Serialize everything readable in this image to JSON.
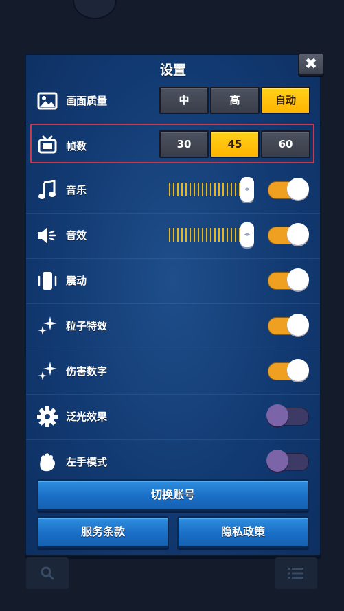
{
  "title": "设置",
  "close_label": "✖",
  "rows": {
    "quality": {
      "label": "画面质量",
      "options": [
        "中",
        "高",
        "自动"
      ],
      "selected": "自动"
    },
    "fps": {
      "label": "帧数",
      "options": [
        "30",
        "45",
        "60"
      ],
      "selected": "45"
    },
    "music": {
      "label": "音乐",
      "volume_percent": 100,
      "enabled": true
    },
    "sfx": {
      "label": "音效",
      "volume_percent": 100,
      "enabled": true
    },
    "vibration": {
      "label": "震动",
      "enabled": true
    },
    "particles": {
      "label": "粒子特效",
      "enabled": true
    },
    "damage_numbers": {
      "label": "伤害数字",
      "enabled": true
    },
    "bloom": {
      "label": "泛光效果",
      "enabled": false
    },
    "left_hand": {
      "label": "左手模式",
      "enabled": false
    }
  },
  "buttons": {
    "switch_account": "切换账号",
    "terms": "服务条款",
    "privacy": "隐私政策"
  },
  "colors": {
    "accent": "#ffc20a",
    "toggle_on": "#f0a020",
    "toggle_off": "#3d3a66",
    "panel": "#123a72",
    "highlight_border": "#c83a4a"
  },
  "icons": [
    "image-icon",
    "tv-icon",
    "music-note-icon",
    "speaker-icon",
    "phone-vibrate-icon",
    "sparkle-icon",
    "sparkle-icon",
    "gear-icon",
    "hand-icon",
    "search-icon",
    "list-icon"
  ]
}
